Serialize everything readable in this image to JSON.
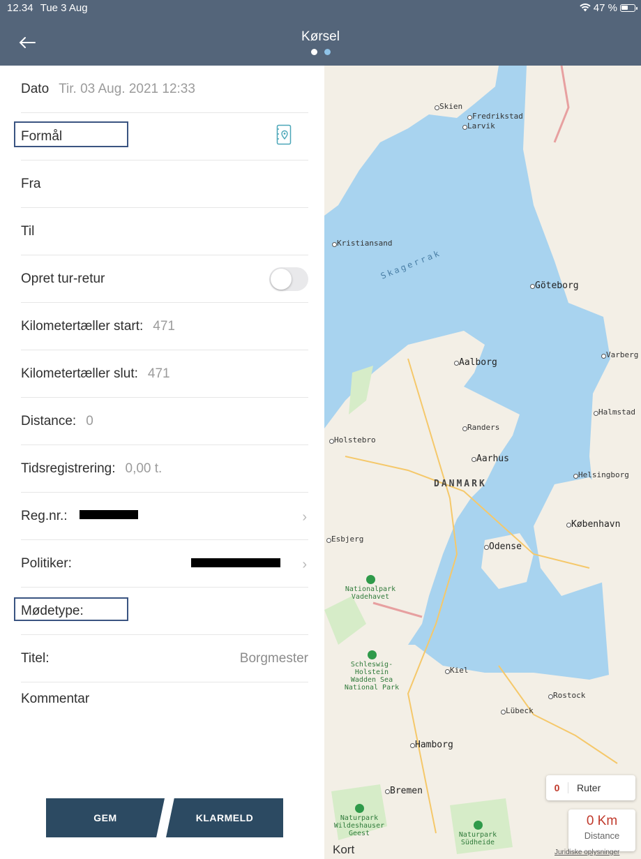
{
  "status_bar": {
    "time": "12.34",
    "date": "Tue 3 Aug",
    "battery": "47 %"
  },
  "nav": {
    "title": "Kørsel"
  },
  "form": {
    "dato_label": "Dato",
    "dato_value": "Tir. 03 Aug. 2021 12:33",
    "formal_label": "Formål",
    "fra_label": "Fra",
    "til_label": "Til",
    "tur_retur_label": "Opret tur-retur",
    "tur_retur_on": false,
    "km_start_label": "Kilometertæller start:",
    "km_start_value": "471",
    "km_slut_label": "Kilometertæller slut:",
    "km_slut_value": "471",
    "distance_label": "Distance:",
    "distance_value": "0",
    "tid_label": "Tidsregistrering:",
    "tid_value": "0,00 t.",
    "regnr_label": "Reg.nr.:",
    "politiker_label": "Politiker:",
    "modetype_label": "Mødetype:",
    "titel_label": "Titel:",
    "titel_value": "Borgmester",
    "kommentar_label": "Kommentar"
  },
  "buttons": {
    "gem": "GEM",
    "klarmeld": "KLARMELD"
  },
  "map": {
    "cities": {
      "skien": "Skien",
      "fredrikstad": "Fredrikstad",
      "larvik": "Larvik",
      "kristiansand": "Kristiansand",
      "goteborg": "Göteborg",
      "varberg": "Varberg",
      "aalborg": "Aalborg",
      "halmstad": "Halmstad",
      "randers": "Randers",
      "holstebro": "Holstebro",
      "aarhus": "Aarhus",
      "helsingborg": "Helsingborg",
      "kobenhavn": "København",
      "esbjerg": "Esbjerg",
      "odense": "Odense",
      "kiel": "Kiel",
      "rostock": "Rostock",
      "lubeck": "Lübeck",
      "hamborg": "Hamborg",
      "bremen": "Bremen"
    },
    "country": "DANMARK",
    "sea": "Skagerrak",
    "parks": {
      "vadehavet": "Nationalpark\nVadehavet",
      "schleswig": "Schleswig-\nHolstein\nWadden Sea\nNational Park",
      "wildeshauser": "Naturpark\nWildeshauser\nGeest",
      "sudheide": "Naturpark\nSüdheide"
    },
    "ruter_count": "0",
    "ruter_label": "Ruter",
    "distance_value": "0 Km",
    "distance_label": "Distance",
    "attribution": "Kort",
    "legal": "Juridiske oplysninger"
  },
  "colors": {
    "nav_bg": "#54657a",
    "button_bg": "#2c4a62",
    "highlight": "#3a5481",
    "accent_red": "#c0392b"
  }
}
